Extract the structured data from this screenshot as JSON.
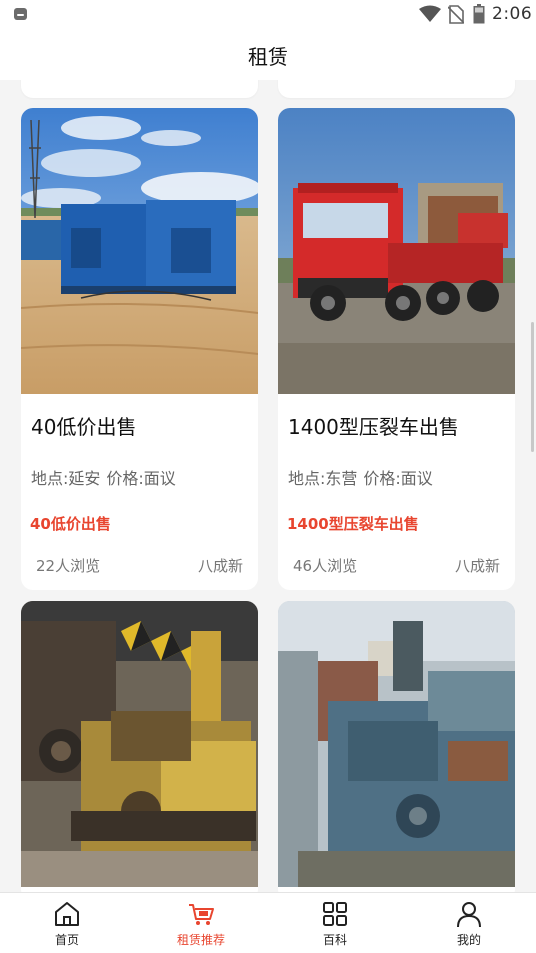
{
  "status_bar": {
    "time": "2:06"
  },
  "header": {
    "title": "租赁"
  },
  "listings": [
    {
      "title": "40低价出售",
      "location": "地点:延安",
      "price": "价格:面议",
      "highlight": "40低价出售",
      "views": "22人浏览",
      "condition": "八成新"
    },
    {
      "title": "1400型压裂车出售",
      "location": "地点:东营",
      "price": "价格:面议",
      "highlight": "1400型压裂车出售",
      "views": "46人浏览",
      "condition": "八成新"
    }
  ],
  "bottom_nav": [
    {
      "label": "首页",
      "icon": "home-icon"
    },
    {
      "label": "租赁推荐",
      "icon": "cart-icon",
      "active": true
    },
    {
      "label": "百科",
      "icon": "grid-icon"
    },
    {
      "label": "我的",
      "icon": "person-icon"
    }
  ],
  "colors": {
    "accent": "#e8452f",
    "background": "#f4f4f4"
  }
}
